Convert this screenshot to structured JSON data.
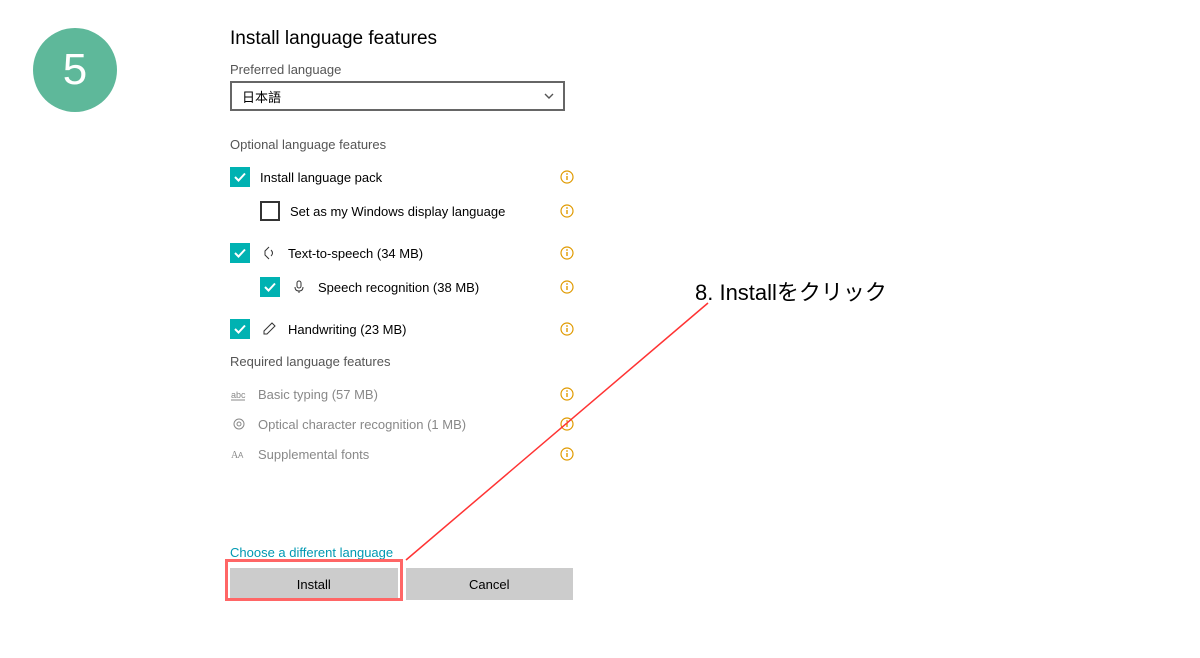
{
  "step": {
    "number": "5"
  },
  "dialog": {
    "title": "Install language features",
    "preferred_label": "Preferred language",
    "preferred_value": "日本語",
    "optional_label": "Optional language features",
    "options": {
      "lang_pack": "Install language pack",
      "display_lang": "Set as my Windows display language",
      "tts": "Text-to-speech (34 MB)",
      "speech_rec": "Speech recognition (38 MB)",
      "handwriting": "Handwriting (23 MB)"
    },
    "required_label": "Required language features",
    "required": {
      "basic_typing": "Basic typing (57 MB)",
      "ocr": "Optical character recognition (1 MB)",
      "fonts": "Supplemental fonts"
    },
    "choose_diff": "Choose a different language",
    "install_btn": "Install",
    "cancel_btn": "Cancel"
  },
  "annotation": {
    "text": "8.  Installをクリック"
  },
  "colors": {
    "badge": "#5eb89a",
    "accent_cyan": "#00b2b2",
    "link": "#0099b2",
    "highlight": "#ff6666",
    "info": "#e09a00"
  }
}
